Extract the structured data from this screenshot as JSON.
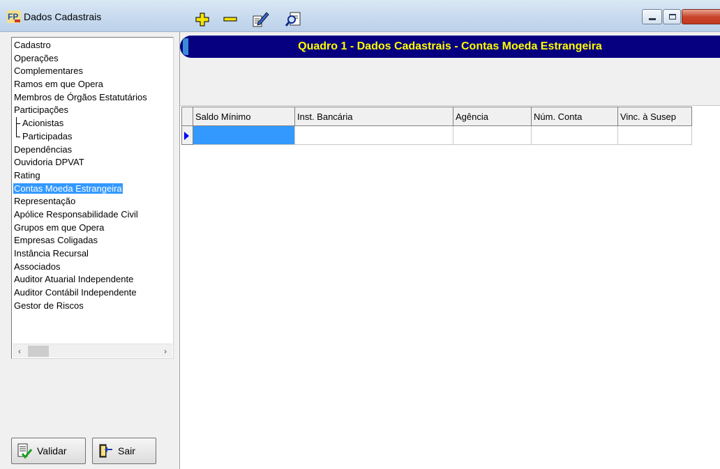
{
  "window": {
    "title": "Dados Cadastrais"
  },
  "banner": {
    "title": "Quadro 1 - Dados Cadastrais - Contas Moeda Estrangeira"
  },
  "tree": {
    "items": [
      {
        "label": "Cadastro",
        "level": 0
      },
      {
        "label": "Operações",
        "level": 0
      },
      {
        "label": "Complementares",
        "level": 0
      },
      {
        "label": "Ramos em que Opera",
        "level": 0
      },
      {
        "label": "Membros de Órgãos Estatutários",
        "level": 0
      },
      {
        "label": "Participações",
        "level": 0
      },
      {
        "label": "Acionistas",
        "level": 1
      },
      {
        "label": "Participadas",
        "level": 1
      },
      {
        "label": "Dependências",
        "level": 0
      },
      {
        "label": "Ouvidoria DPVAT",
        "level": 0
      },
      {
        "label": "Rating",
        "level": 0
      },
      {
        "label": "Contas Moeda Estrangeira",
        "level": 0,
        "selected": true
      },
      {
        "label": "Representação",
        "level": 0
      },
      {
        "label": "Apólice Responsabilidade Civil",
        "level": 0
      },
      {
        "label": "Grupos em que Opera",
        "level": 0
      },
      {
        "label": "Empresas Coligadas",
        "level": 0
      },
      {
        "label": "Instância Recursal",
        "level": 0
      },
      {
        "label": "Associados",
        "level": 0
      },
      {
        "label": "Auditor Atuarial Independente",
        "level": 0
      },
      {
        "label": "Auditor Contábil Independente",
        "level": 0
      },
      {
        "label": "Gestor de Riscos",
        "level": 0
      }
    ]
  },
  "buttons": {
    "validar": "Validar",
    "sair": "Sair"
  },
  "toolbar": {
    "icons": [
      "add-icon",
      "remove-icon",
      "edit-icon",
      "find-icon"
    ]
  },
  "grid": {
    "columns": [
      "Saldo Mínimo",
      "Inst. Bancária",
      "Agência",
      "Núm. Conta",
      "Vinc. à Susep"
    ],
    "rows": [
      [
        "",
        "",
        "",
        "",
        ""
      ]
    ]
  },
  "colors": {
    "banner_bg": "#060080",
    "banner_text": "#ffff00",
    "selection": "#3399ff"
  }
}
